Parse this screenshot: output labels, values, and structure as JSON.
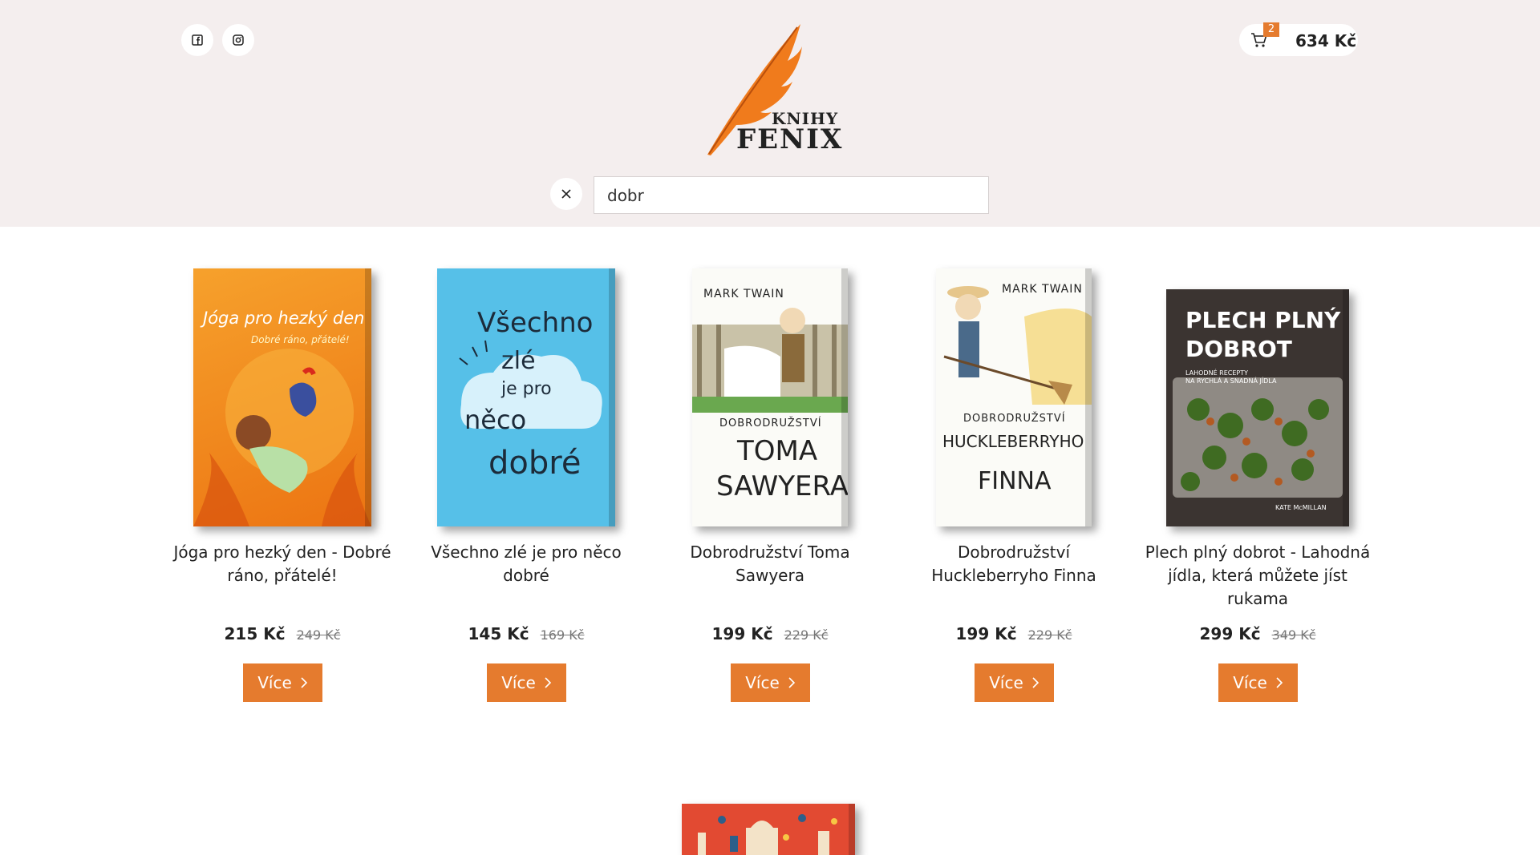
{
  "header": {
    "social": [
      {
        "icon": "facebook-icon"
      },
      {
        "icon": "instagram-icon"
      }
    ],
    "logo": {
      "line1": "KNIHY",
      "line2": "FENIX"
    },
    "cart": {
      "count": "2",
      "total": "634 Kč"
    },
    "search": {
      "value": "dobr"
    }
  },
  "products": [
    {
      "title": "Jóga pro hezký den - Dobré ráno, přátelé!",
      "price": "215 Kč",
      "old_price": "249 Kč",
      "button": "Více",
      "cover": {
        "line1": "Jóga pro hezký den",
        "line2": "Dobré ráno, přátelé!",
        "bg": "#f08a1c"
      }
    },
    {
      "title": "Všechno zlé je pro něco dobré",
      "price": "145 Kč",
      "old_price": "169 Kč",
      "button": "Více",
      "cover": {
        "line1": "Všechno",
        "line2": "zlé",
        "line3": "je pro",
        "line4": "něco",
        "line5": "dobré",
        "bg": "#56c0e8"
      }
    },
    {
      "title": "Dobrodružství Toma Sawyera",
      "price": "199 Kč",
      "old_price": "229 Kč",
      "button": "Více",
      "cover": {
        "author": "MARK TWAIN",
        "line1": "DOBRODRUŽSTVÍ",
        "line2": "TOMA",
        "line3": "SAWYERA",
        "bg": "#fbfbf7"
      }
    },
    {
      "title": "Dobrodružství Huckleberryho Finna",
      "price": "199 Kč",
      "old_price": "229 Kč",
      "button": "Více",
      "cover": {
        "author": "MARK TWAIN",
        "line1": "DOBRODRUŽSTVÍ",
        "line2": "HUCKLEBERRYHO",
        "line3": "FINNA",
        "bg": "#fbfbf7"
      }
    },
    {
      "title": "Plech plný dobrot - Lahodná jídla, která můžete jíst rukama",
      "price": "299 Kč",
      "old_price": "349 Kč",
      "button": "Více",
      "cover": {
        "line1": "PLECH PLNÝ",
        "line2": "DOBROT",
        "line3": "LAHODNÉ RECEPTY",
        "line4": "NA RYCHLÁ A SNADNÁ JÍDLA",
        "author": "KATE McMILLAN",
        "bg": "#3b3431"
      }
    }
  ],
  "colors": {
    "accent": "#e57b2e",
    "header_bg": "#f4eeee"
  }
}
